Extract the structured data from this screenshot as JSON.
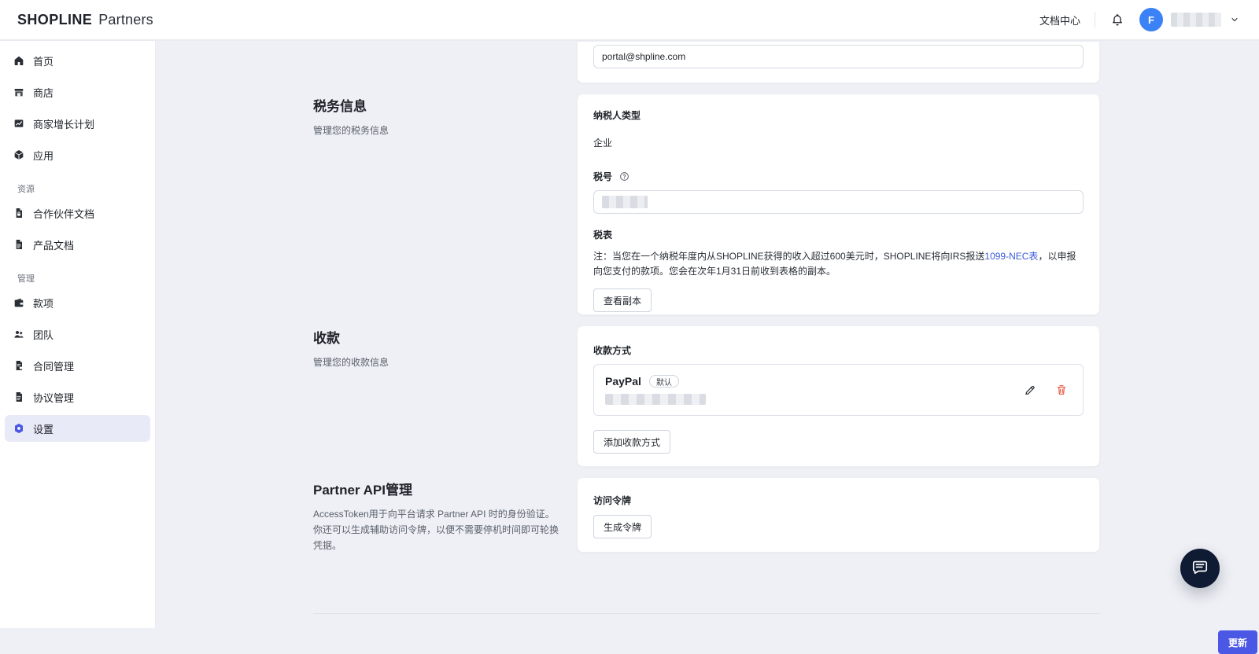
{
  "header": {
    "brand_logo": "SHOPLINE",
    "brand_suffix": "Partners",
    "doc_center": "文档中心",
    "avatar_letter": "F"
  },
  "sidebar": {
    "items_top": [
      {
        "label": "首页",
        "icon": "home-icon"
      },
      {
        "label": "商店",
        "icon": "store-icon"
      },
      {
        "label": "商家增长计划",
        "icon": "chart-icon"
      },
      {
        "label": "应用",
        "icon": "cube-icon"
      }
    ],
    "section_resources": "资源",
    "items_resources": [
      {
        "label": "合作伙伴文档",
        "icon": "doc-lock-icon"
      },
      {
        "label": "产品文档",
        "icon": "doc-icon"
      }
    ],
    "section_manage": "管理",
    "items_manage": [
      {
        "label": "款项",
        "icon": "wallet-icon"
      },
      {
        "label": "团队",
        "icon": "team-icon"
      },
      {
        "label": "合同管理",
        "icon": "contract-icon"
      },
      {
        "label": "协议管理",
        "icon": "agreement-icon"
      },
      {
        "label": "设置",
        "icon": "settings-icon",
        "active": true
      }
    ]
  },
  "email_card": {
    "email_value": "portal@shpline.com"
  },
  "tax": {
    "title": "税务信息",
    "desc": "管理您的税务信息",
    "taxpayer_type_label": "纳税人类型",
    "taxpayer_type_value": "企业",
    "tax_id_label": "税号",
    "tax_form_label": "税表",
    "note_prefix": "注：当您在一个纳税年度内从SHOPLINE获得的收入超过600美元时，SHOPLINE将向IRS报送",
    "note_link": "1099-NEC表",
    "note_suffix": "，以申报向您支付的款项。您会在次年1月31日前收到表格的副本。",
    "view_copy_button": "查看副本"
  },
  "payout": {
    "title": "收款",
    "desc": "管理您的收款信息",
    "method_label": "收款方式",
    "method_name": "PayPal",
    "default_badge": "默认",
    "add_button": "添加收款方式"
  },
  "api": {
    "title": "Partner API管理",
    "desc": "AccessToken用于向平台请求 Partner API 时的身份验证。你还可以生成辅助访问令牌，以便不需要停机时间即可轮换凭据。",
    "token_label": "访问令牌",
    "generate_button": "生成令牌"
  },
  "footer": {
    "update_button": "更新"
  },
  "colors": {
    "brand": "#4b57e5",
    "danger": "#e5533d",
    "avatar": "#3b82f6",
    "chat": "#0f1b33"
  }
}
